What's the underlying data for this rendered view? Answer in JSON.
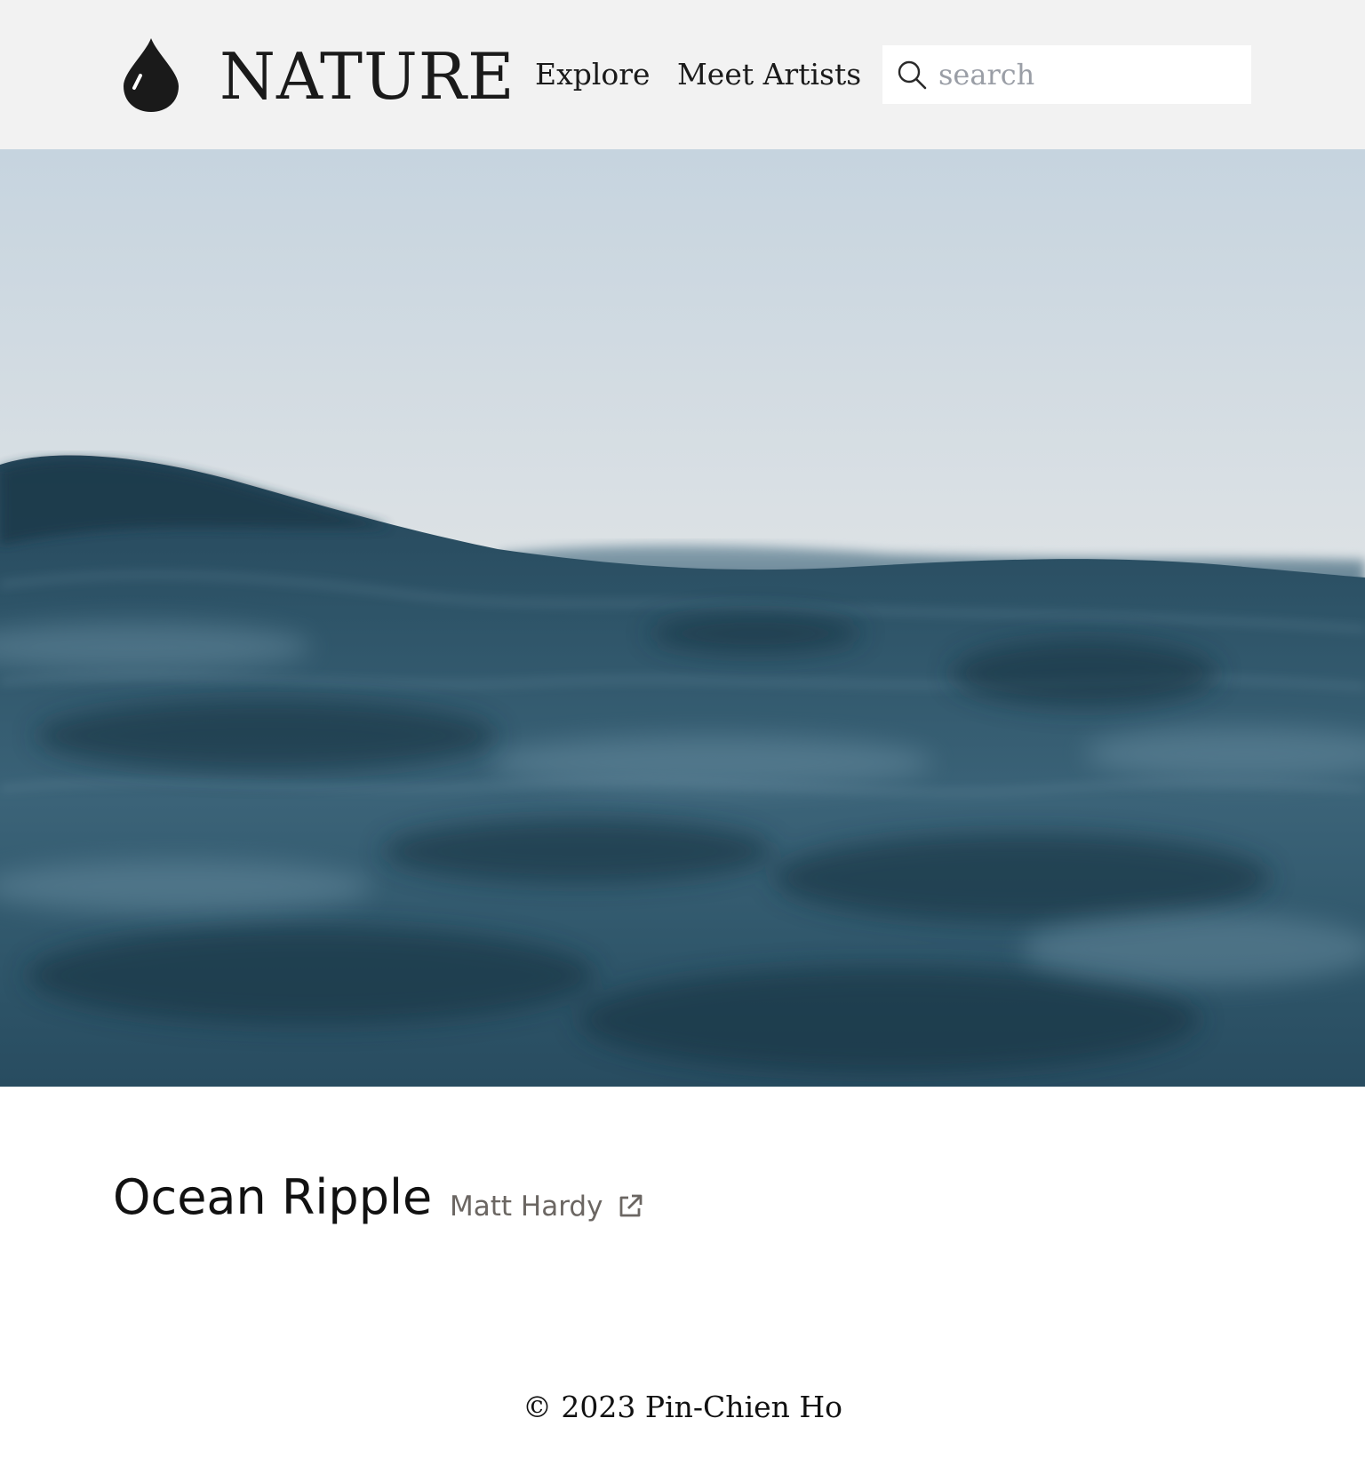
{
  "header": {
    "brand": "NATURE",
    "logo_icon": "water-drop-icon",
    "nav": [
      {
        "label": "Explore"
      },
      {
        "label": "Meet Artists"
      }
    ],
    "search": {
      "placeholder": "search",
      "value": "",
      "icon": "search-icon"
    }
  },
  "photo": {
    "title": "Ocean Ripple",
    "artist": "Matt Hardy",
    "artist_link_icon": "external-link-icon",
    "subject": "ocean wave at dusk"
  },
  "footer": {
    "copyright": "© 2023 Pin-Chien Ho"
  },
  "colors": {
    "header_bg": "#f2f2f2",
    "text": "#1a1a1a",
    "muted": "#6b6662",
    "placeholder": "#9a9ea6"
  }
}
